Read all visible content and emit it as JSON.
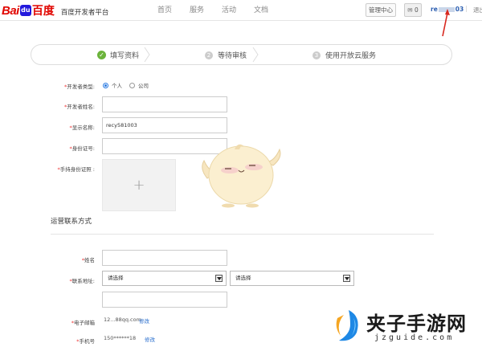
{
  "header": {
    "logo_bai": "Bai",
    "logo_paw": "du",
    "logo_du": "百度",
    "logo_subtitle": "百度开发者平台",
    "nav": [
      "首页",
      "服务",
      "活动",
      "文档"
    ],
    "manage_label": "管理中心",
    "message_count": "0",
    "user_prefix": "re",
    "user_suffix": "03",
    "separator": "|",
    "logout_label": "退出"
  },
  "steps": [
    {
      "label": "填写资料",
      "state": "done"
    },
    {
      "num": "2",
      "label": "等待审核"
    },
    {
      "num": "3",
      "label": "使用开放云服务"
    }
  ],
  "form": {
    "developer_type_label": "开发者类型:",
    "type_options": [
      "个人",
      "公司"
    ],
    "selected_type": "个人",
    "developer_name_label": "开发者姓名:",
    "display_name_label": "显示名称:",
    "display_name_value": "recy581003",
    "id_number_label": "身份证号:",
    "id_photo_label": "手持身份证照 :",
    "upload_symbol": "+",
    "section_title": "运营联系方式",
    "name_label": "姓名",
    "address_label": "联系地址:",
    "select_placeholder_1": "请选择",
    "select_placeholder_2": "请选择",
    "email_label": "电子邮箱",
    "email_value": "12...88qq.com",
    "email_edit": "修改",
    "phone_label": "手机号",
    "phone_value": "150******18",
    "phone_edit": "修改"
  },
  "watermark": {
    "title": "夹子手游网",
    "url": "jzguide.com"
  },
  "colors": {
    "brand_red": "#e10601",
    "brand_blue": "#2319dc",
    "success_green": "#6bb33b",
    "link_blue": "#2a6fcf",
    "required_red": "#e33333"
  }
}
